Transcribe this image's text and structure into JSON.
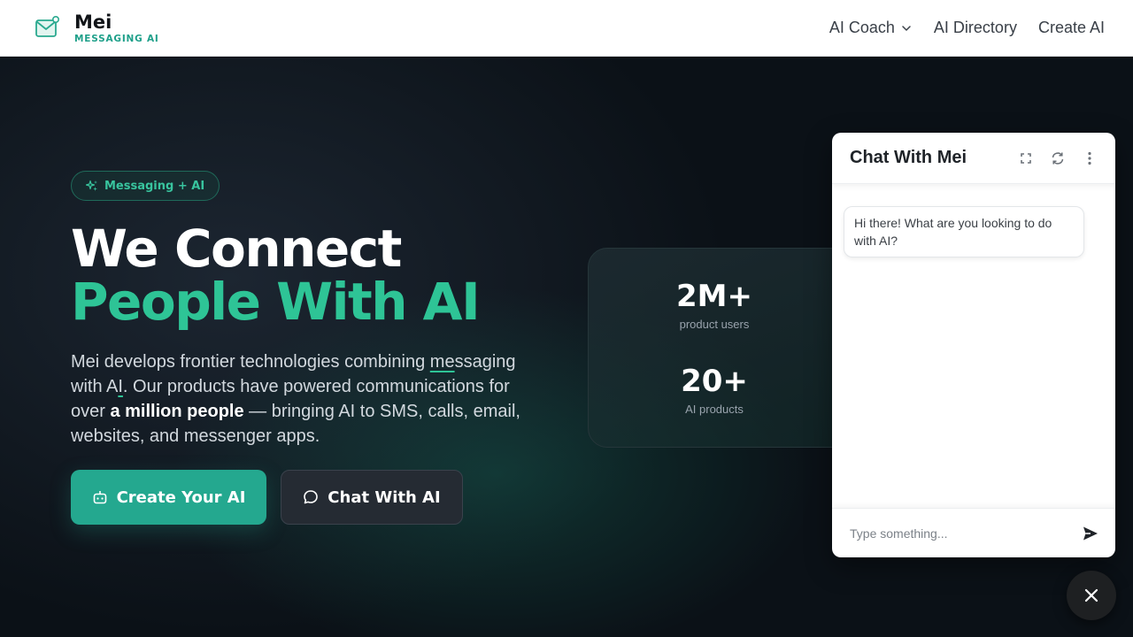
{
  "brand": {
    "name": "Mei",
    "subtitle": "MESSAGING AI",
    "logo_icon": "mail-check-icon"
  },
  "nav": {
    "items": [
      {
        "label": "AI Coach",
        "icon": "chevron-down-icon"
      },
      {
        "label": "AI Directory"
      },
      {
        "label": "Create AI"
      }
    ]
  },
  "hero": {
    "badge": {
      "label": "Messaging + AI",
      "icon": "sparkles-icon"
    },
    "headline_line1": "We Connect",
    "headline_line2": "People With AI",
    "description": {
      "part1": "Mei develops frontier technologies combining ",
      "underlined": "me",
      "part2": "ssaging with A",
      "underlined2": "I",
      "part3": ". Our products have powered communications for over ",
      "bold": "a million people",
      "part4": " — bringing AI to SMS, calls, email, websites, and messenger apps."
    },
    "primary_button": {
      "label": "Create Your AI",
      "icon": "robot-icon"
    },
    "secondary_button": {
      "label": "Chat With AI",
      "icon": "chat-bubble-icon"
    }
  },
  "stats": [
    {
      "value": "2M+",
      "label": "product users"
    },
    {
      "value": "20+",
      "label": "AI products"
    }
  ],
  "chat": {
    "title": "Chat With Mei",
    "tools": [
      "expand-icon",
      "refresh-icon",
      "more-vertical-icon"
    ],
    "messages": [
      {
        "from": "bot",
        "text": "Hi there! What are you looking to do with AI?"
      }
    ],
    "input_placeholder": "Type something...",
    "send_icon": "send-icon"
  },
  "close_button_icon": "close-icon",
  "colors": {
    "accent": "#24a88f",
    "accent_text": "#2ec496",
    "background": "#0b1117",
    "header": "#ffffff"
  }
}
